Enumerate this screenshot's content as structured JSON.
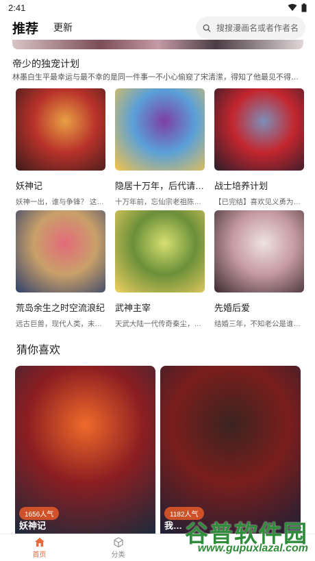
{
  "status_bar": {
    "time": "2:41"
  },
  "header": {
    "tab_recommend": "推荐",
    "tab_update": "更新",
    "search_placeholder": "搜搜漫画名或者作者名"
  },
  "feature": {
    "title": "帝少的独宠计划",
    "description": "林墨白生平最幸运与最不幸的是同一件事一不小心偷窥了宋清潆，得知了他最见不得光的秘…"
  },
  "grid_items": [
    {
      "title": "妖神记",
      "desc": "妖神一出，谁与争锋？ 这…",
      "colors": [
        "#3b1b1b",
        "#b8322a",
        "#e9a045"
      ]
    },
    {
      "title": "隐居十万年，后代请…",
      "desc": "十万年前，忘仙宗老祖陈…",
      "colors": [
        "#f4c34a",
        "#5aa0d8",
        "#7d3fa6"
      ]
    },
    {
      "title": "战士培养计划",
      "desc": "【已完结】喜欢见义勇为…",
      "colors": [
        "#2a1d2a",
        "#c3262e",
        "#7e8fb8"
      ]
    },
    {
      "title": "荒岛余生之时空流浪纪",
      "desc": "远古巨兽，现代人类，未…",
      "colors": [
        "#2e3f6b",
        "#c9a06a",
        "#e36b7a"
      ]
    },
    {
      "title": "武神主宰",
      "desc": "天武大陆一代传奇秦尘，…",
      "colors": [
        "#f0d060",
        "#6b8f3a",
        "#d8e070"
      ]
    },
    {
      "title": "先婚后爱",
      "desc": "结婚三年，不知老公是谁…",
      "colors": [
        "#3a2a30",
        "#c59aa0",
        "#efe2e2"
      ]
    }
  ],
  "section": {
    "title": "猜你喜欢"
  },
  "big_cards": [
    {
      "title": "妖神记",
      "popularity": "1656人气",
      "colors": [
        "#f06a2a",
        "#8c1e22",
        "#1c2a3a"
      ]
    },
    {
      "title": "我…",
      "popularity": "1182人气",
      "colors": [
        "#3b2320",
        "#7a1e1c",
        "#1c2036"
      ]
    }
  ],
  "bottom_nav": [
    {
      "label": "首页",
      "active": true,
      "icon": "home-icon"
    },
    {
      "label": "分类",
      "active": false,
      "icon": "category-icon"
    }
  ],
  "watermark": {
    "cn": "谷普软件园",
    "url": "www.gupuxlazal.com"
  },
  "accent_color": "#e86b3c"
}
